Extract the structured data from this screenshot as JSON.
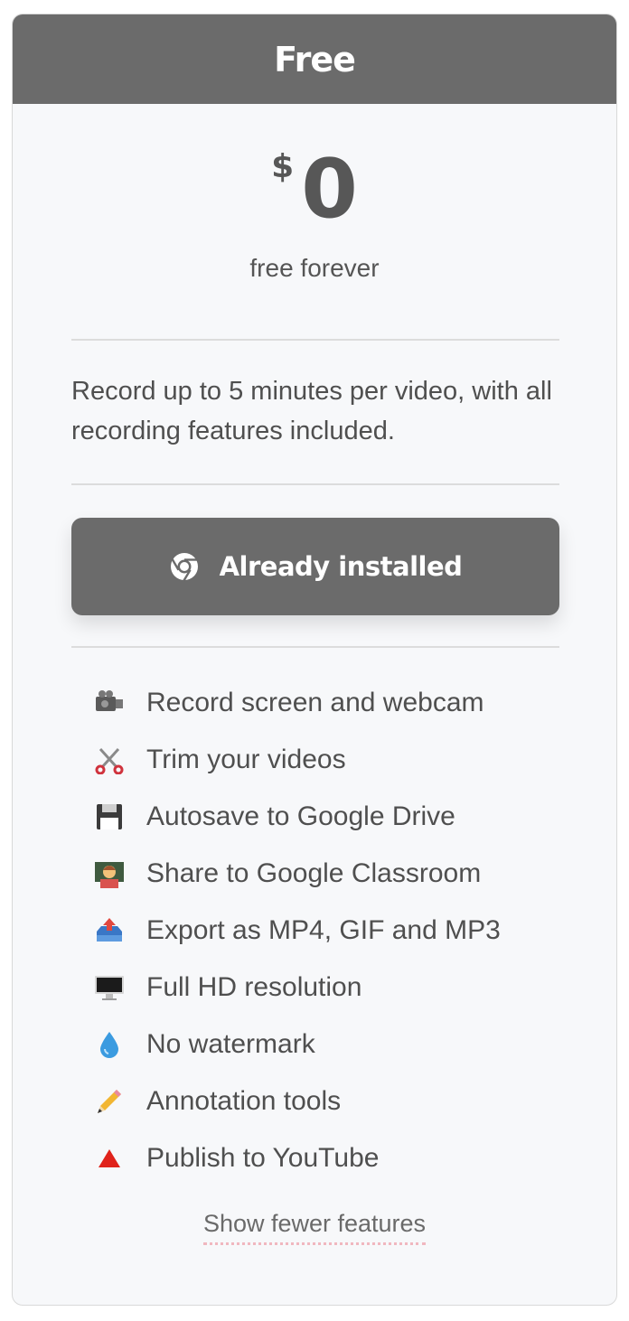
{
  "plan": {
    "name": "Free",
    "currency": "$",
    "amount": "0",
    "period": "free forever",
    "description": "Record up to 5 minutes per video, with all recording features included."
  },
  "install_button": {
    "label": "Already installed",
    "icon": "chrome-icon"
  },
  "features": [
    {
      "icon": "video-camera-icon",
      "label": "Record screen and webcam"
    },
    {
      "icon": "scissors-icon",
      "label": "Trim your videos"
    },
    {
      "icon": "floppy-disk-icon",
      "label": "Autosave to Google Drive"
    },
    {
      "icon": "teacher-icon",
      "label": "Share to Google Classroom"
    },
    {
      "icon": "outbox-tray-icon",
      "label": "Export as MP4, GIF and MP3"
    },
    {
      "icon": "desktop-computer-icon",
      "label": "Full HD resolution"
    },
    {
      "icon": "droplet-icon",
      "label": "No watermark"
    },
    {
      "icon": "pencil-icon",
      "label": "Annotation tools"
    },
    {
      "icon": "red-triangle-icon",
      "label": "Publish to YouTube"
    }
  ],
  "toggle_link": "Show fewer features",
  "colors": {
    "header": "#6b6b6b",
    "button": "#6b6b6b",
    "card_bg": "#f7f8fa",
    "link_underline": "#f0b7bf"
  }
}
